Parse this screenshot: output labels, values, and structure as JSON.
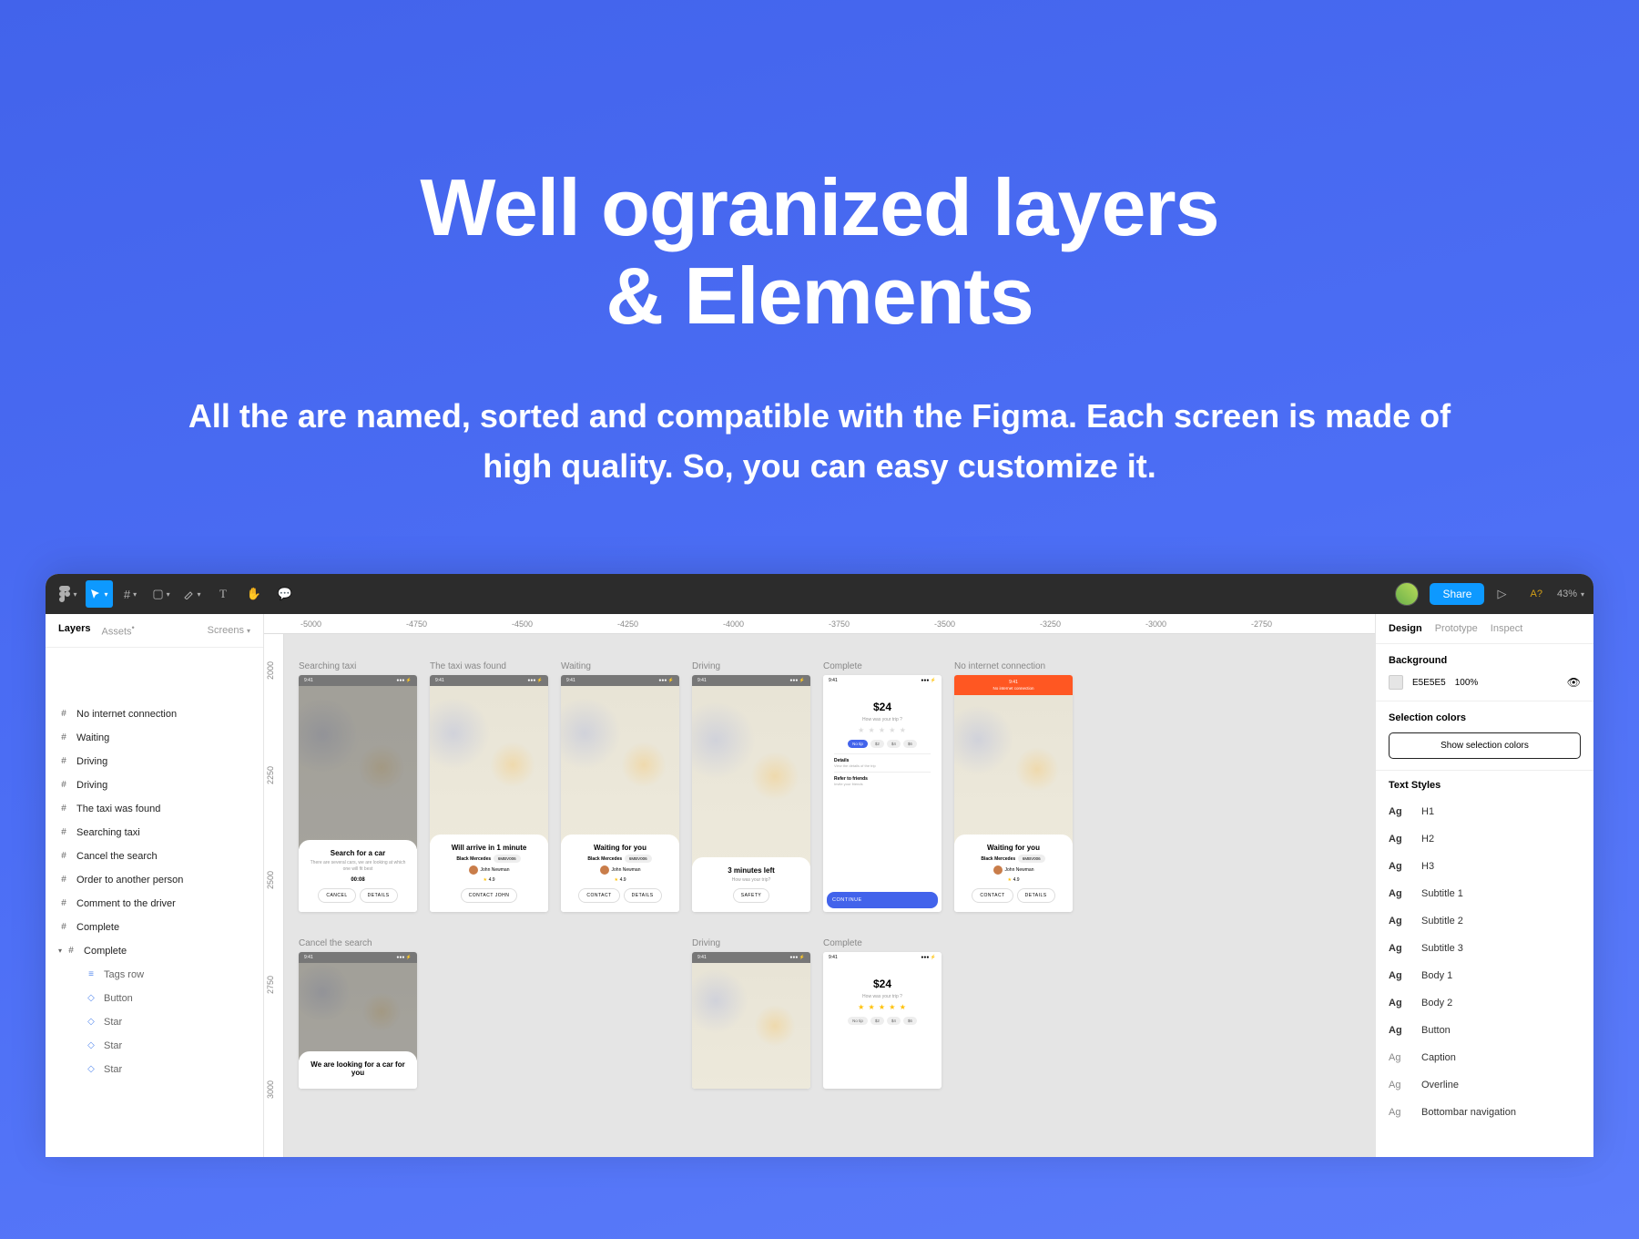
{
  "hero": {
    "title_line1": "Well ogranized layers",
    "title_line2": "& Elements",
    "subtitle": "All the are named, sorted and compatible with the Figma. Each screen is made of high quality. So, you can easy customize it."
  },
  "toolbar": {
    "share": "Share",
    "missing_fonts": "A?",
    "zoom": "43%"
  },
  "left_panel": {
    "tab_layers": "Layers",
    "tab_assets": "Assets",
    "pages_label": "Screens",
    "layers": [
      {
        "icon": "#",
        "label": "No internet connection"
      },
      {
        "icon": "#",
        "label": "Waiting"
      },
      {
        "icon": "#",
        "label": "Driving"
      },
      {
        "icon": "#",
        "label": "Driving"
      },
      {
        "icon": "#",
        "label": "The taxi was found"
      },
      {
        "icon": "#",
        "label": "Searching taxi"
      },
      {
        "icon": "#",
        "label": "Cancel the search"
      },
      {
        "icon": "#",
        "label": "Order to another person"
      },
      {
        "icon": "#",
        "label": "Comment to the driver"
      },
      {
        "icon": "#",
        "label": "Complete"
      }
    ],
    "expanded": {
      "label": "Complete",
      "children": [
        {
          "ic": "≡",
          "label": "Tags row"
        },
        {
          "ic": "◇",
          "label": "Button"
        },
        {
          "ic": "◇",
          "label": "Star"
        },
        {
          "ic": "◇",
          "label": "Star"
        },
        {
          "ic": "◇",
          "label": "Star"
        }
      ]
    }
  },
  "ruler_h": [
    "-5000",
    "-4750",
    "-4500",
    "-4250",
    "-4000",
    "-3750",
    "-3500",
    "-3250",
    "-3000",
    "-2750"
  ],
  "ruler_v": [
    "2000",
    "2250",
    "2500",
    "2750",
    "3000"
  ],
  "frames": [
    {
      "label": "Searching taxi",
      "type": "map-dark",
      "time": "9:41",
      "title": "Search for a car",
      "sub": "There are several cars, we are looking at which one will fit best",
      "extra": "00:08",
      "btn1": "CANCEL",
      "btn2": "DETAILS"
    },
    {
      "label": "The taxi was found",
      "type": "map",
      "time": "9:41",
      "title": "Will arrive in 1 minute",
      "car": "Black Mercedes",
      "plate": "6MBV006",
      "driver": "John Newman",
      "rating": "4.9",
      "btn1": "CONTACT JOHN"
    },
    {
      "label": "Waiting",
      "type": "map",
      "time": "9:41",
      "title": "Waiting for you",
      "car": "Black Mercedes",
      "plate": "6MBV006",
      "driver": "John Newman",
      "rating": "4.9",
      "btn1": "CONTACT",
      "btn2": "DETAILS"
    },
    {
      "label": "Driving",
      "type": "map",
      "time": "9:41",
      "title": "3 minutes left",
      "sub": "How was your trip?",
      "btn1": "SAFETY"
    },
    {
      "label": "Complete",
      "type": "complete",
      "time": "9:41",
      "price": "$24",
      "howwas": "How was your trip ?",
      "tips": [
        "No tip",
        "$2",
        "$4",
        "$6"
      ],
      "details_label": "Details",
      "details_sub": "View the details of the trip",
      "refer_label": "Refer to friends",
      "refer_sub": "Invite your friends",
      "continue": "CONTINUE"
    },
    {
      "label": "No internet connection",
      "type": "map-orange",
      "time": "9:41",
      "banner": "No internet connection",
      "title": "Waiting for you",
      "car": "Black Mercedes",
      "plate": "6MBV006",
      "driver": "John Newman",
      "rating": "4.9",
      "btn1": "CONTACT",
      "btn2": "DETAILS"
    }
  ],
  "frames2": [
    {
      "label": "Cancel the search",
      "type": "map-dark",
      "time": "9:41",
      "title": "We are looking for a car for you"
    },
    {
      "label": "Driving",
      "type": "map",
      "time": "9:41"
    },
    {
      "label": "Complete",
      "type": "complete-gold",
      "time": "9:41",
      "price": "$24",
      "howwas": "How was your trip ?",
      "tips": [
        "No tip",
        "$2",
        "$4",
        "$6"
      ]
    }
  ],
  "right_panel": {
    "tab_design": "Design",
    "tab_prototype": "Prototype",
    "tab_inspect": "Inspect",
    "bg_label": "Background",
    "bg_hex": "E5E5E5",
    "bg_opacity": "100%",
    "sel_label": "Selection colors",
    "sel_btn": "Show selection colors",
    "ts_label": "Text Styles",
    "styles": [
      {
        "ag": "Ag",
        "name": "H1",
        "b": true
      },
      {
        "ag": "Ag",
        "name": "H2",
        "b": true
      },
      {
        "ag": "Ag",
        "name": "H3",
        "b": true
      },
      {
        "ag": "Ag",
        "name": "Subtitle 1",
        "b": true
      },
      {
        "ag": "Ag",
        "name": "Subtitle 2",
        "b": true
      },
      {
        "ag": "Ag",
        "name": "Subtitle 3",
        "b": true
      },
      {
        "ag": "Ag",
        "name": "Body 1",
        "b": true
      },
      {
        "ag": "Ag",
        "name": "Body 2",
        "b": true
      },
      {
        "ag": "Ag",
        "name": "Button",
        "b": true
      },
      {
        "ag": "Ag",
        "name": "Caption",
        "b": false
      },
      {
        "ag": "Ag",
        "name": "Overline",
        "b": false
      },
      {
        "ag": "Ag",
        "name": "Bottombar navigation",
        "b": false
      }
    ]
  }
}
